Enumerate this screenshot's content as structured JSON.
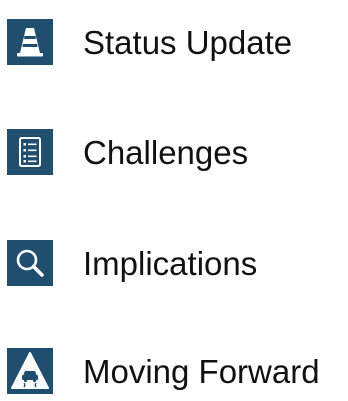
{
  "colors": {
    "icon_tile": "#1f4e6e",
    "icon_glyph": "#ffffff",
    "text": "#111111",
    "background": "#ffffff"
  },
  "agenda": {
    "items": [
      {
        "icon": "traffic-cone-icon",
        "label": "Status Update"
      },
      {
        "icon": "checklist-icon",
        "label": "Challenges"
      },
      {
        "icon": "magnifying-glass-icon",
        "label": "Implications"
      },
      {
        "icon": "slippery-road-icon",
        "label": "Moving Forward"
      }
    ]
  }
}
